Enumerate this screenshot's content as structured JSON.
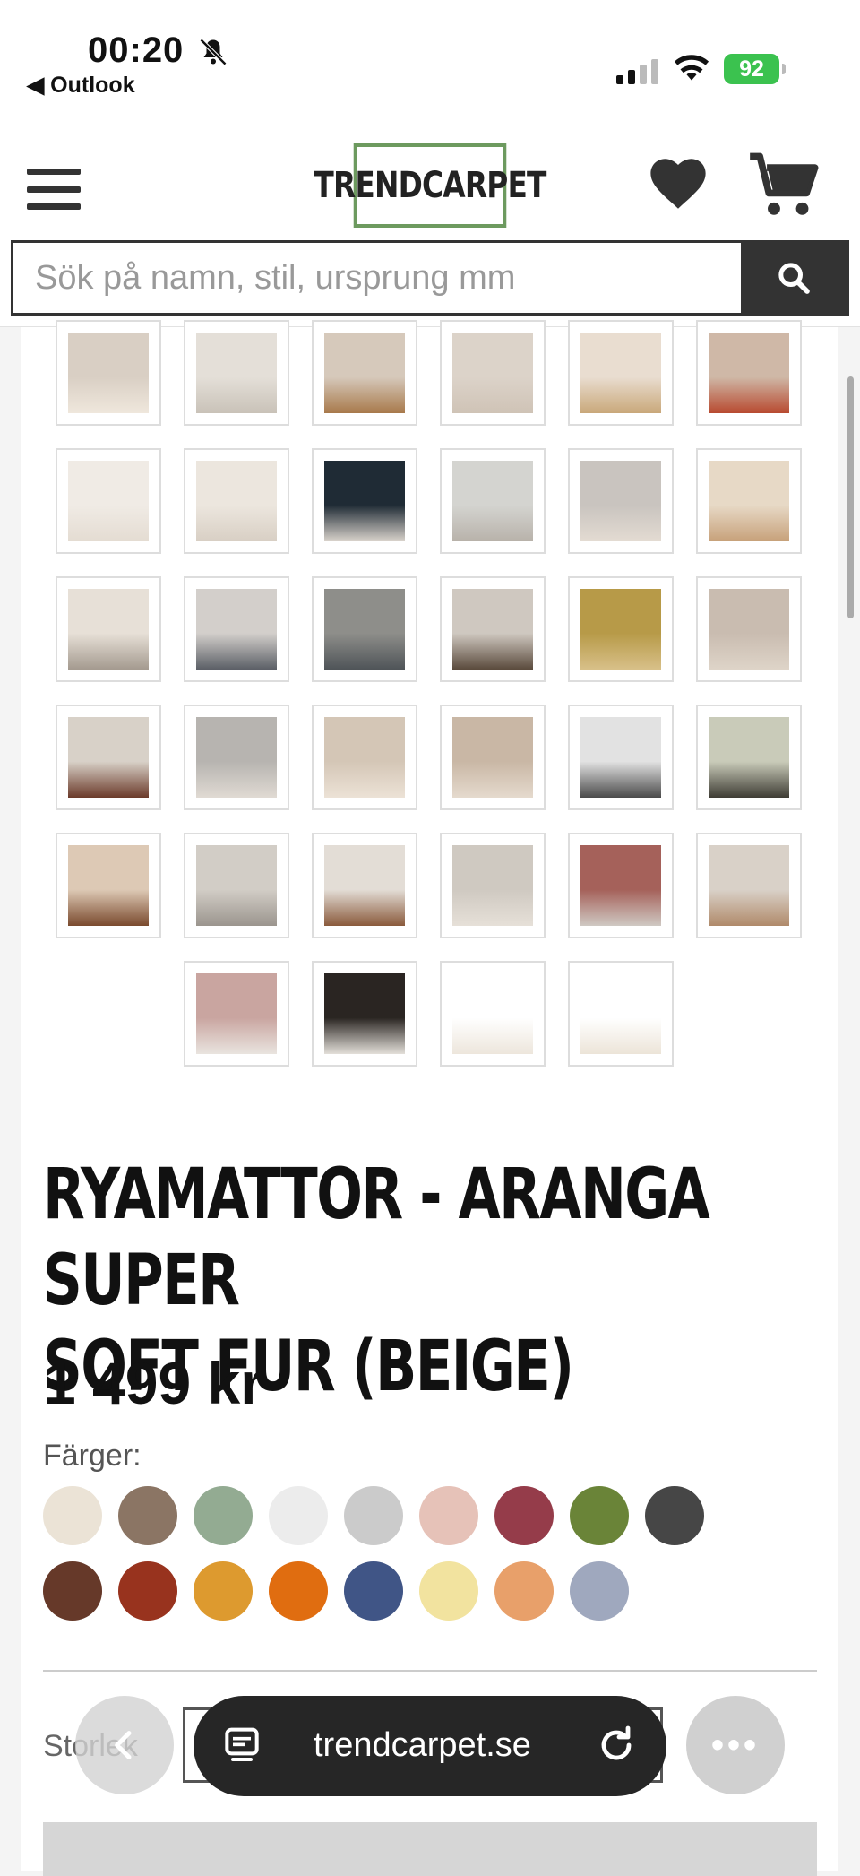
{
  "status_bar": {
    "time": "00:20",
    "back_app": "◀ Outlook",
    "battery": "92"
  },
  "header": {
    "logo_text": "TRENDCARPET",
    "search_placeholder": "Sök på namn, stil, ursprung mm"
  },
  "gallery": {
    "rows": [
      [
        {
          "top": "#d9cfc4",
          "bottom": "#efe7dc"
        },
        {
          "top": "#e4dfd8",
          "bottom": "#c9c2b8"
        },
        {
          "top": "#d6c9bb",
          "bottom": "#a8794b"
        },
        {
          "top": "#dcd3c9",
          "bottom": "#cfc3b6"
        },
        {
          "top": "#e9ddd0",
          "bottom": "#c9a87a"
        },
        {
          "top": "#cfb8a7",
          "bottom": "#b84a30"
        }
      ],
      [
        {
          "top": "#f0ebe5",
          "bottom": "#e4dcd2"
        },
        {
          "top": "#ece6de",
          "bottom": "#d8cfc4"
        },
        {
          "top": "#1f2b35",
          "bottom": "#d8d2cb"
        },
        {
          "top": "#d4d4d0",
          "bottom": "#b8b2aa"
        },
        {
          "top": "#c9c4bf",
          "bottom": "#e3dbd2"
        },
        {
          "top": "#e7d9c6",
          "bottom": "#c7a17a"
        }
      ],
      [
        {
          "top": "#e7e0d7",
          "bottom": "#a49a8f"
        },
        {
          "top": "#d3cfcb",
          "bottom": "#5b5f66"
        },
        {
          "top": "#8e8e8a",
          "bottom": "#4f5458"
        },
        {
          "top": "#cfc8c0",
          "bottom": "#5a4a3c"
        },
        {
          "top": "#b79a48",
          "bottom": "#d8c089"
        },
        {
          "top": "#c9bcb0",
          "bottom": "#ded4c8"
        }
      ],
      [
        {
          "top": "#d8d1c8",
          "bottom": "#6b3a2a"
        },
        {
          "top": "#b7b4b0",
          "bottom": "#e0dad3"
        },
        {
          "top": "#d4c6b6",
          "bottom": "#ece2d6"
        },
        {
          "top": "#c9b7a5",
          "bottom": "#e5dacd"
        },
        {
          "top": "#e2e2e2",
          "bottom": "#4a4a4a"
        },
        {
          "top": "#c9cbb9",
          "bottom": "#3e3c34"
        }
      ],
      [
        {
          "top": "#ddc9b5",
          "bottom": "#7a4a2e"
        },
        {
          "top": "#d2cdc6",
          "bottom": "#9b958e"
        },
        {
          "top": "#e3ddd6",
          "bottom": "#8a5a3c"
        },
        {
          "top": "#cfc9c1",
          "bottom": "#e6e0d8"
        },
        {
          "top": "#a5615a",
          "bottom": "#cfc9c3"
        },
        {
          "top": "#d9d1c8",
          "bottom": "#b08a6a"
        }
      ],
      [
        {
          "top": "#c9a5a0",
          "bottom": "#e9e4df"
        },
        {
          "top": "#2a2522",
          "bottom": "#e3dfd9"
        },
        {
          "top": "#ffffff",
          "bottom": "#ede6dc"
        },
        {
          "top": "#ffffff",
          "bottom": "#ece4d8"
        }
      ]
    ]
  },
  "product": {
    "title_line1": "RYAMATTOR - ARANGA SUPER",
    "title_line2": "SOFT FUR (BEIGE)",
    "price": "1 499 kr",
    "colors_label": "Färger:",
    "colors": [
      "#ebe3d6",
      "#8b7564",
      "#93ab92",
      "#ececec",
      "#cbcbcb",
      "#e6c2b8",
      "#953c4a",
      "#6a8438",
      "#464646",
      "#663929",
      "#98331e",
      "#dd9a2f",
      "#e06d10",
      "#405586",
      "#f2e39f",
      "#e8a06a",
      "#9fa8be"
    ],
    "size_label": "Storlek"
  },
  "browser": {
    "url": "trendcarpet.se"
  }
}
